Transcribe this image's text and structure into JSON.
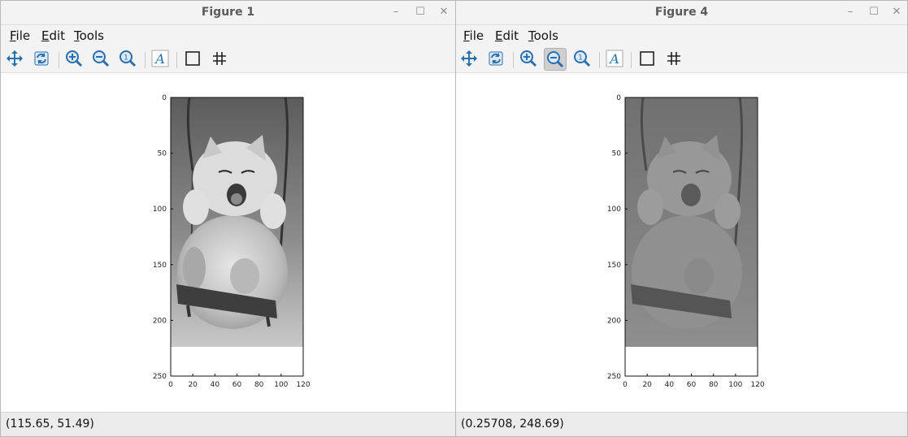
{
  "windows": [
    {
      "title": "Figure 1",
      "menu": [
        "File",
        "Edit",
        "Tools"
      ],
      "status": "(115.65, 51.49)",
      "axes": {
        "x_ticks": [
          "0",
          "20",
          "40",
          "60",
          "80",
          "100",
          "120"
        ],
        "y_ticks": [
          "0",
          "50",
          "100",
          "150",
          "200",
          "250"
        ]
      },
      "image_style": "original-grayscale"
    },
    {
      "title": "Figure 4",
      "menu": [
        "File",
        "Edit",
        "Tools"
      ],
      "status": "(0.25708, 248.69)",
      "axes": {
        "x_ticks": [
          "0",
          "20",
          "40",
          "60",
          "80",
          "100",
          "120"
        ],
        "y_ticks": [
          "0",
          "50",
          "100",
          "150",
          "200",
          "250"
        ]
      },
      "image_style": "low-contrast-grayscale"
    }
  ],
  "toolbar_icons": [
    "pan-icon",
    "rotate-icon",
    "zoom-in-icon",
    "zoom-out-icon",
    "zoom-reset-icon",
    "text-icon",
    "box-icon",
    "grid-icon"
  ],
  "colors": {
    "accent_blue": "#2a6fb0",
    "toolbar_bg": "#f3f3f3"
  }
}
